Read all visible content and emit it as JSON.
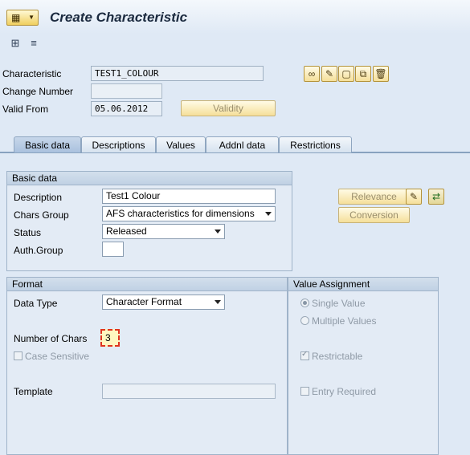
{
  "header": {
    "title": "Create Characteristic"
  },
  "toolbar": {
    "icons": [
      "hierarchy-icon",
      "print-icon"
    ]
  },
  "fields": {
    "characteristic": {
      "label": "Characteristic",
      "value": "TEST1_COLOUR"
    },
    "change_number": {
      "label": "Change Number",
      "value": ""
    },
    "valid_from": {
      "label": "Valid From",
      "value": "05.06.2012"
    },
    "validity_button": "Validity"
  },
  "tabs": [
    {
      "label": "Basic data",
      "active": true
    },
    {
      "label": "Descriptions"
    },
    {
      "label": "Values"
    },
    {
      "label": "Addnl data"
    },
    {
      "label": "Restrictions"
    }
  ],
  "basic_data": {
    "title": "Basic data",
    "description": {
      "label": "Description",
      "value": "Test1 Colour"
    },
    "chars_group": {
      "label": "Chars Group",
      "value": "AFS characteristics for dimensions"
    },
    "status": {
      "label": "Status",
      "value": "Released"
    },
    "auth_group": {
      "label": "Auth.Group",
      "value": ""
    }
  },
  "side_buttons": {
    "relevance": "Relevance",
    "conversion": "Conversion"
  },
  "format": {
    "title": "Format",
    "data_type": {
      "label": "Data Type",
      "value": "Character Format"
    },
    "num_chars": {
      "label": "Number of Chars",
      "value": "3"
    },
    "case_sensitive": "Case Sensitive",
    "template": {
      "label": "Template",
      "value": ""
    }
  },
  "value_assignment": {
    "title": "Value Assignment",
    "single_value": "Single Value",
    "multiple_values": "Multiple Values",
    "restrictable": "Restrictable",
    "entry_required": "Entry Required"
  },
  "colors": {
    "accent": "#f5df9a",
    "tab_active": "#aac1de",
    "background": "#dfe9f5"
  }
}
